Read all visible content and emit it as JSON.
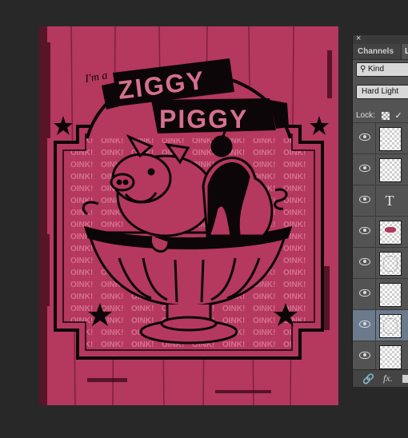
{
  "artwork": {
    "intro_text": "I'm a",
    "title_line1": "ZIGGY",
    "title_line2": "PIGGY",
    "pattern_word": "OINK!",
    "colors": {
      "background": "#b5385e",
      "ink": "#0c0608",
      "pattern": "#d6708f"
    }
  },
  "panel": {
    "close_glyph": "×",
    "tabs": {
      "channels": "Channels",
      "layers": "La"
    },
    "kind_filter": {
      "icon": "search-icon",
      "label": "Kind"
    },
    "blend_mode": "Hard Light",
    "lock_label": "Lock:",
    "layers": [
      {
        "type": "raster",
        "thumb": "blank"
      },
      {
        "type": "raster",
        "thumb": "blank"
      },
      {
        "type": "text",
        "glyph": "T"
      },
      {
        "type": "raster",
        "thumb": "pink"
      },
      {
        "type": "raster",
        "thumb": "sketch"
      },
      {
        "type": "raster",
        "thumb": "blank"
      },
      {
        "type": "raster",
        "thumb": "sketch",
        "active": true
      },
      {
        "type": "raster",
        "thumb": "blank"
      }
    ],
    "footer": {
      "link_icon": "link-icon",
      "fx_label": "fx."
    }
  }
}
